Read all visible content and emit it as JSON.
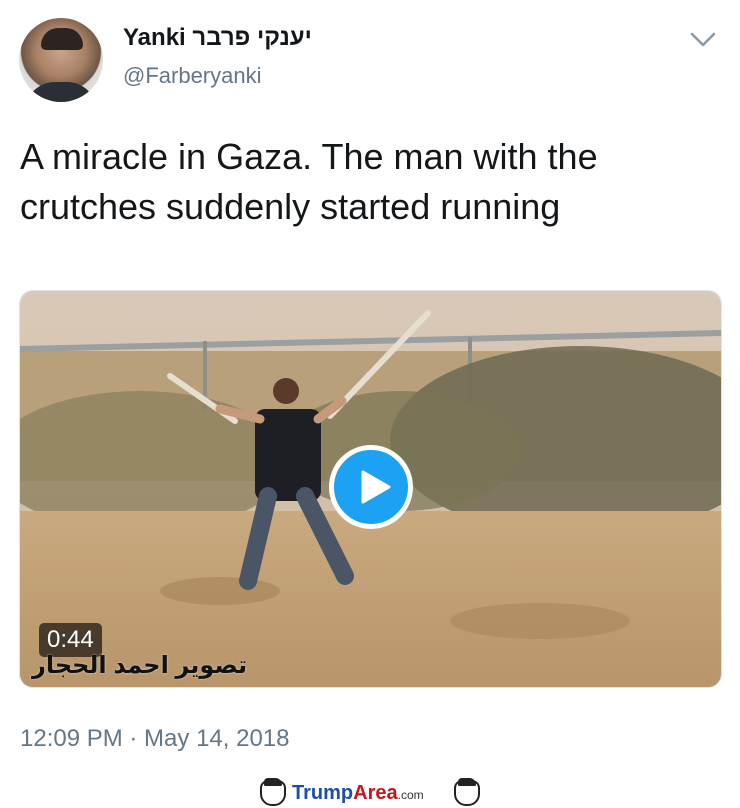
{
  "author": {
    "display_name": "Yanki יענקי פרבר",
    "handle": "@Farberyanki",
    "avatar_icon": "profile-photo"
  },
  "menu": {
    "icon": "chevron-down-icon"
  },
  "tweet": {
    "text": "A miracle in Gaza. The man with the crutches suddenly started running"
  },
  "media": {
    "type": "video",
    "duration": "0:44",
    "caption_overlay": "تصوير احمد الحجار",
    "play_icon": "play-icon",
    "accent_color": "#1da1f2"
  },
  "meta": {
    "timestamp": "12:09 PM · May 14, 2018"
  },
  "watermark_logo": {
    "brand_first": "Trump",
    "brand_second": "Area",
    "brand_suffix": ".com",
    "colors": {
      "first": "#1b4fa8",
      "second": "#c4161c"
    }
  }
}
